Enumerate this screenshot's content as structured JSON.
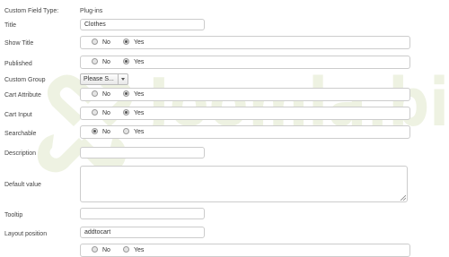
{
  "watermark": {
    "text": "Joomla.bi",
    "color": "#eef2e2"
  },
  "form": {
    "custom_field_type": {
      "label": "Custom Field Type:",
      "value": "Plug-ins"
    },
    "title": {
      "label": "Title",
      "value": "Clothes"
    },
    "show_title": {
      "label": "Show Title",
      "options": [
        "No",
        "Yes"
      ],
      "selected": "Yes"
    },
    "published": {
      "label": "Published",
      "options": [
        "No",
        "Yes"
      ],
      "selected": "Yes"
    },
    "custom_group": {
      "label": "Custom Group",
      "selected_value": "Please S..."
    },
    "cart_attribute": {
      "label": "Cart Attribute",
      "options": [
        "No",
        "Yes"
      ],
      "selected": "Yes"
    },
    "cart_input": {
      "label": "Cart Input",
      "options": [
        "No",
        "Yes"
      ],
      "selected": "Yes"
    },
    "searchable": {
      "label": "Searchable",
      "options": [
        "No",
        "Yes"
      ],
      "selected": "No"
    },
    "description": {
      "label": "Description",
      "value": ""
    },
    "default_value": {
      "label": "Default value",
      "value": ""
    },
    "tooltip": {
      "label": "Tooltip",
      "value": ""
    },
    "layout_position": {
      "label": "Layout position",
      "value": "addtocart"
    },
    "next_row": {
      "options": [
        "No",
        "Yes"
      ]
    }
  }
}
